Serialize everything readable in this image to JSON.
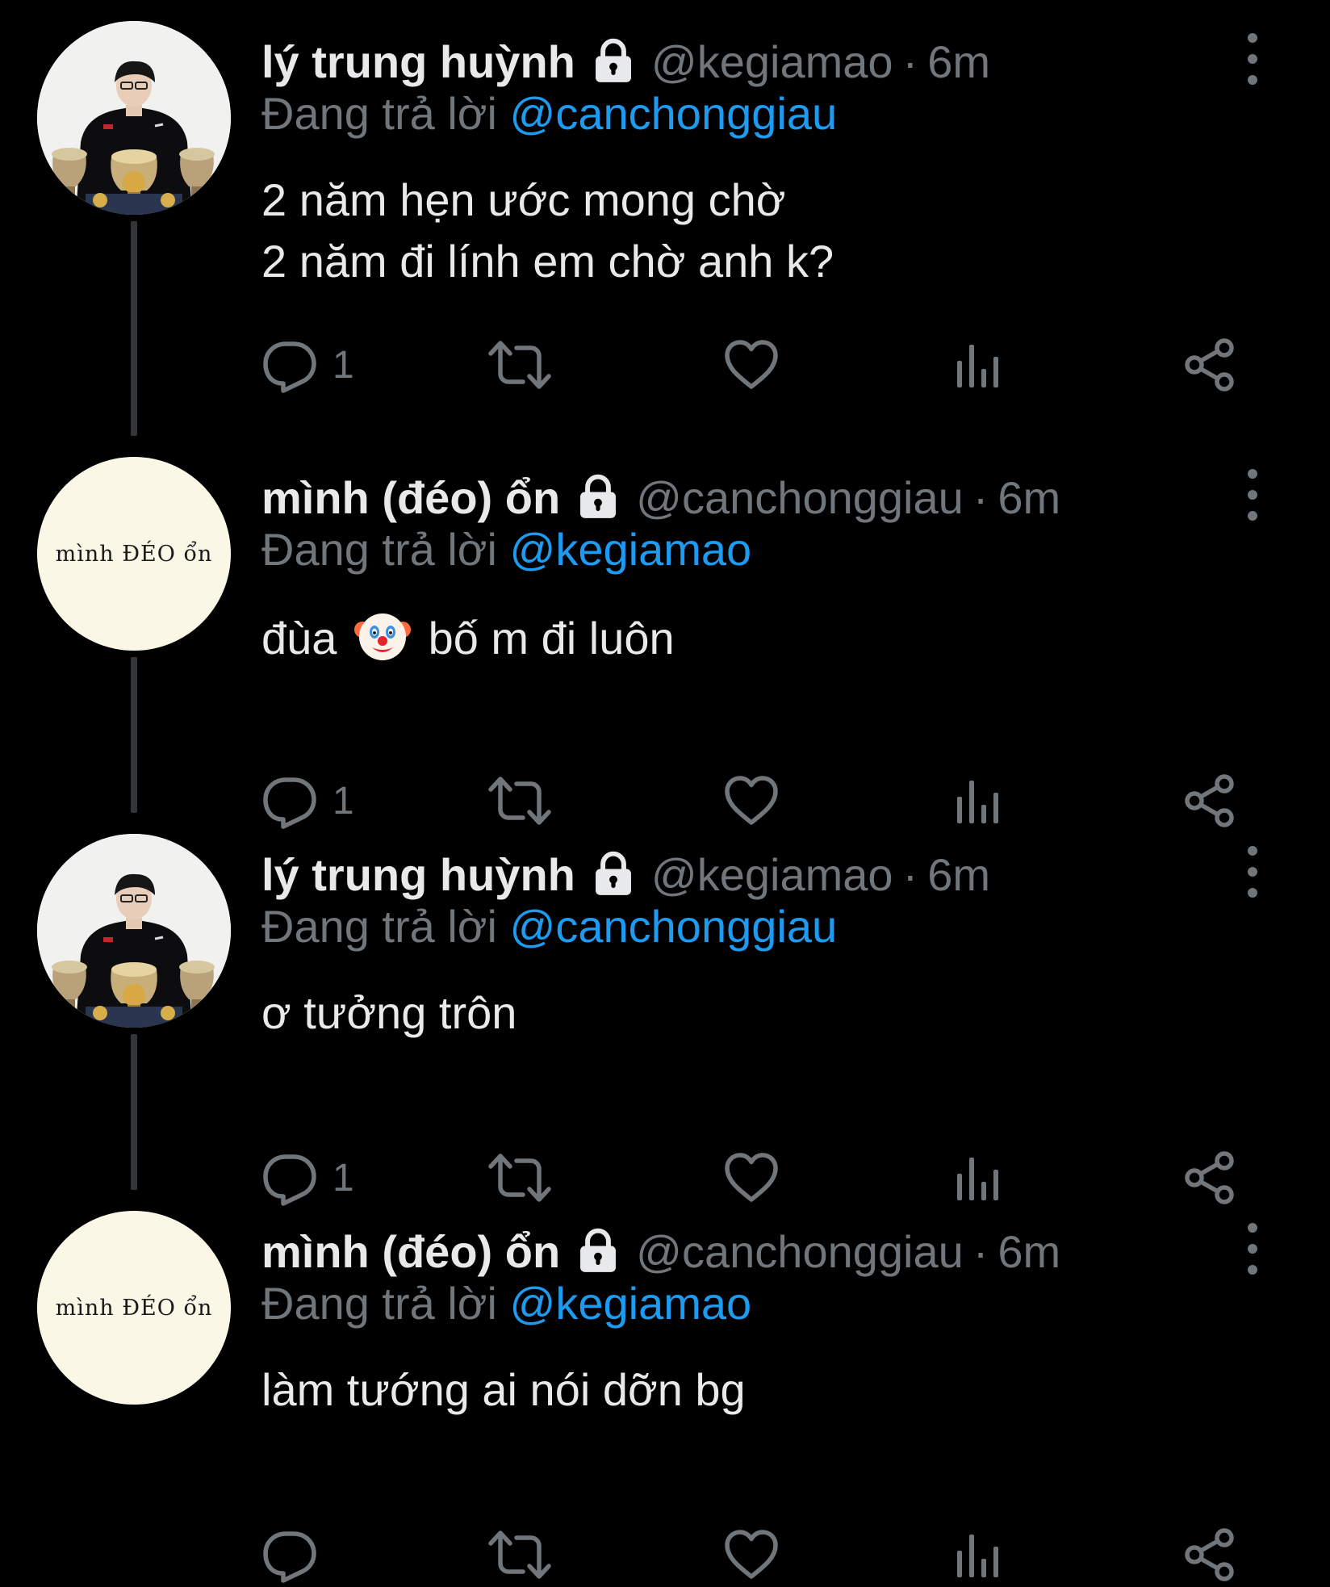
{
  "thread": {
    "tweets": [
      {
        "display_name": "lý trung huỳnh",
        "handle": "@kegiamao",
        "separator": "·",
        "time": "6m",
        "reply_prefix": "Đang trả lời",
        "reply_to": "@canchonggiau",
        "text_line1": "2 năm hẹn ước mong chờ",
        "text_line2": "2 năm đi lính em chờ anh k?",
        "reply_count": "1",
        "avatar_type": "photo"
      },
      {
        "display_name": "mình (đéo) ổn",
        "handle": "@canchonggiau",
        "separator": "·",
        "time": "6m",
        "reply_prefix": "Đang trả lời",
        "reply_to": "@kegiamao",
        "text_before": "đùa",
        "text_after": "bố m đi luôn",
        "text_emoji": "clown-face",
        "reply_count": "1",
        "avatar_type": "text",
        "avatar_text": "mình ĐÉO ổn"
      },
      {
        "display_name": "lý trung huỳnh",
        "handle": "@kegiamao",
        "separator": "·",
        "time": "6m",
        "reply_prefix": "Đang trả lời",
        "reply_to": "@canchonggiau",
        "text_line1": "ơ tưởng trôn",
        "reply_count": "1",
        "avatar_type": "photo"
      },
      {
        "display_name": "mình (đéo) ổn",
        "handle": "@canchonggiau",
        "separator": "·",
        "time": "6m",
        "reply_prefix": "Đang trả lời",
        "reply_to": "@kegiamao",
        "text_line1": "làm tướng ai nói dỡn bg",
        "reply_count": "",
        "avatar_type": "text",
        "avatar_text": "mình ĐÉO ổn"
      }
    ]
  },
  "colors": {
    "background": "#000000",
    "primary_text": "#e7e9ea",
    "secondary_text": "#71767b",
    "accent": "#1d9bf0",
    "thread_line": "#333639"
  },
  "icons": {
    "lock": "lock-icon",
    "more": "more-vertical-icon",
    "reply": "reply-bubble-icon",
    "retweet": "retweet-icon",
    "like": "heart-icon",
    "views": "analytics-icon",
    "share": "share-icon"
  }
}
